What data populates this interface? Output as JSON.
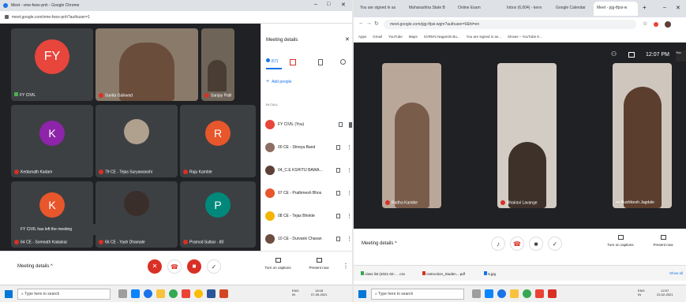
{
  "left_window": {
    "window_title": "Meet - vme-fwsx-pnh - Google Chrome",
    "url": "meet.google.com/vme-fwsx-pnh?authuser=1",
    "window_controls": [
      "–",
      "□",
      "✕"
    ],
    "tiles": [
      {
        "name": "FY CIVIL",
        "initial": "FY",
        "color": "#e8453c"
      },
      {
        "name": "Sunita Gaikwad",
        "initial": "",
        "color": "#8a6d5a"
      },
      {
        "name": "Sanjay Patil",
        "initial": "",
        "color": "#6b5a4a"
      },
      {
        "name": "Kedarnath Kadam",
        "initial": "K",
        "color": "#8e24aa"
      },
      {
        "name": "79 CE - Tejas Suryawanshi",
        "initial": "",
        "color": "#a08e7a"
      },
      {
        "name": "Raju Kamble",
        "initial": "R",
        "color": "#e8562c"
      },
      {
        "name": "64 CE - Somnath Kalaskar",
        "initial": "K",
        "color": "#e8562c"
      },
      {
        "name": "66 CE - Yash Dhamale",
        "initial": "",
        "color": "#3a2e2a"
      },
      {
        "name": "Pramod Sutkar - 80",
        "initial": "P",
        "color": "#00897b"
      }
    ],
    "toast": "FY CIVIL has left the meeting",
    "meeting_details_label": "Meeting details",
    "panel": {
      "title": "Meeting details",
      "close": "✕",
      "people_count": "(67)",
      "add_people": "Add people",
      "section_label": "IN CALL",
      "people": [
        {
          "name": "FY CIVIL (You)",
          "color": "#e8453c"
        },
        {
          "name": "00 CE - Shreya Band",
          "color": "#8d6e63"
        },
        {
          "name": "04_C.E KSHITIJ BAWA...",
          "color": "#5d4037"
        },
        {
          "name": "07 CE - Prathmesh Bhos",
          "color": "#e8562c"
        },
        {
          "name": "08 CE - Tejas Bhokte",
          "color": "#f4b400"
        },
        {
          "name": "10 CE - Durvank Chavan",
          "color": "#6d4c41"
        }
      ],
      "turn_on_captions": "Turn on captions",
      "present_now": "Present now"
    },
    "taskbar": {
      "search_placeholder": "Type here to search",
      "lang": "ENG",
      "lang2": "IN",
      "time": "18:18",
      "date": "07-05-2021"
    }
  },
  "right_window": {
    "tabs": [
      "You are signed in as",
      "Maharashtra State B",
      "Online Exam",
      "Inbox (6,004) - kenv",
      "Google Calendar",
      "Meet - pjg-tfpsi-w",
      "+"
    ],
    "url": "meet.google.com/pjg-tfpsi-wgm?authuser=0&hl=en",
    "bookmarks": [
      "Apps",
      "Gmail",
      "YouTube",
      "Maps",
      "SVRM's Nagarshi Bu...",
      "You are signed in as...",
      "Shows – YouTube K..."
    ],
    "time_display": "12:07 PM",
    "you_label": "You",
    "tiles": [
      {
        "name": "Radha Kamble"
      },
      {
        "name": "Bhairavi Lavange"
      },
      {
        "name": "Rushikesh Jagdale"
      }
    ],
    "meeting_details_label": "Meeting details",
    "turn_on_captions": "Turn on captions",
    "present_now": "Present now",
    "downloads": [
      "class list (2021-02-... .csv",
      "Instruction_Studen....pdf",
      "5.jpg"
    ],
    "show_all": "Show all",
    "taskbar": {
      "search_placeholder": "Type here to search",
      "lang": "ENG",
      "lang2": "IN",
      "time": "12:07",
      "date": "23-02-2021"
    }
  }
}
